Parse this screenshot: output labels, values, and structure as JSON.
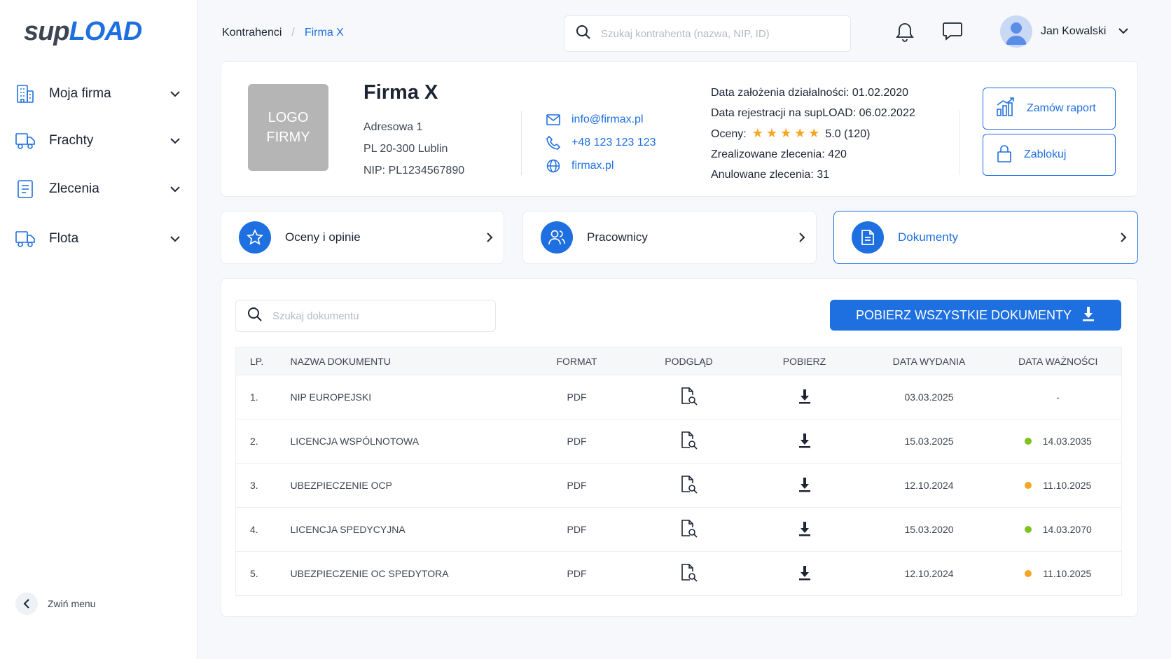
{
  "app": {
    "logo_part1": "sup",
    "logo_part2": "LOAD"
  },
  "sidebar": {
    "items": [
      {
        "label": "Moja firma",
        "icon": "building-icon"
      },
      {
        "label": "Frachty",
        "icon": "truck-icon"
      },
      {
        "label": "Zlecenia",
        "icon": "document-icon"
      },
      {
        "label": "Flota",
        "icon": "truck-icon"
      }
    ],
    "collapse_label": "Zwiń menu"
  },
  "breadcrumb": {
    "parent": "Kontrahenci",
    "separator": "/",
    "current": "Firma X"
  },
  "search": {
    "placeholder": "Szukaj kontrahenta (nazwa, NIP, ID)",
    "value": ""
  },
  "user": {
    "name": "Jan Kowalski"
  },
  "company": {
    "logo_text_line1": "LOGO",
    "logo_text_line2": "FIRMY",
    "name": "Firma X",
    "address_line1": "Adresowa 1",
    "address_line2": "PL 20-300 Lublin",
    "nip": "NIP: PL1234567890",
    "email": "info@firmax.pl",
    "phone": "+48 123 123 123",
    "website": "firmax.pl",
    "stats": {
      "founded_label": "Data założenia działalności:",
      "founded_value": "01.02.2020",
      "registered_label": "Data rejestracji na supLOAD:",
      "registered_value": "06.02.2022",
      "rating_label": "Oceny:",
      "rating_stars": 5,
      "rating_value": "5.0 (120)",
      "completed_label": "Zrealizowane zlecenia:",
      "completed_value": "420",
      "cancelled_label": "Anulowane zlecenia:",
      "cancelled_value": "31"
    },
    "actions": {
      "report": "Zamów raport",
      "block": "Zablokuj"
    }
  },
  "tiles": [
    {
      "label": "Oceny i opinie",
      "icon": "star-icon",
      "active": false
    },
    {
      "label": "Pracownicy",
      "icon": "users-icon",
      "active": false
    },
    {
      "label": "Dokumenty",
      "icon": "file-icon",
      "active": true
    }
  ],
  "documents": {
    "search_placeholder": "Szukaj dokumentu",
    "download_all_label": "POBIERZ WSZYSTKIE DOKUMENTY",
    "columns": [
      "LP.",
      "NAZWA DOKUMENTU",
      "FORMAT",
      "PODGLĄD",
      "POBIERZ",
      "DATA WYDANIA",
      "DATA WAŻNOŚCI"
    ],
    "rows": [
      {
        "lp": "1.",
        "name": "NIP EUROPEJSKI",
        "format": "PDF",
        "issued": "03.03.2025",
        "expires": "-",
        "status": "none"
      },
      {
        "lp": "2.",
        "name": "LICENCJA WSPÓLNOTOWA",
        "format": "PDF",
        "issued": "15.03.2025",
        "expires": "14.03.2035",
        "status": "valid"
      },
      {
        "lp": "3.",
        "name": "UBEZPIECZENIE OCP",
        "format": "PDF",
        "issued": "12.10.2024",
        "expires": "11.10.2025",
        "status": "expiring"
      },
      {
        "lp": "4.",
        "name": "LICENCJA SPEDYCYJNA",
        "format": "PDF",
        "issued": "15.03.2020",
        "expires": "14.03.2070",
        "status": "valid"
      },
      {
        "lp": "5.",
        "name": "UBEZPIECZENIE OC SPEDYTORA",
        "format": "PDF",
        "issued": "12.10.2024",
        "expires": "11.10.2025",
        "status": "expiring"
      }
    ]
  },
  "colors": {
    "accent": "#1e6fe0",
    "valid": "#7cc31c",
    "expiring": "#f5a623",
    "star": "#f5a623"
  }
}
